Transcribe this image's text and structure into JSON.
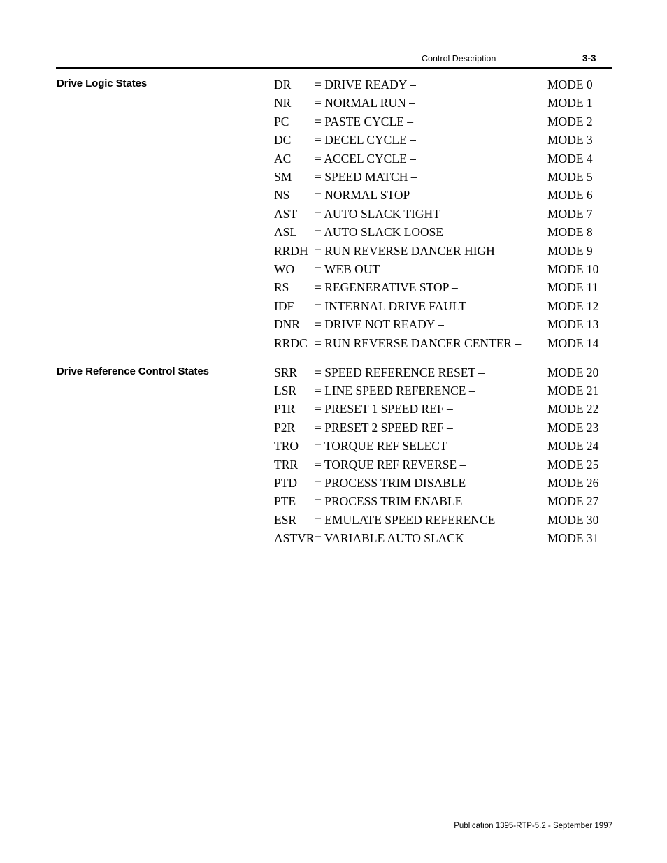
{
  "header": {
    "title": "Control Description",
    "page_number": "3-3"
  },
  "footer": {
    "text": "Publication 1395-RTP-5.2 - September 1997"
  },
  "sections": [
    {
      "heading": "Drive Logic States",
      "rows": [
        {
          "abbr": "DR",
          "desc": "= DRIVE READY –",
          "mode": "MODE 0"
        },
        {
          "abbr": "NR",
          "desc": "= NORMAL RUN –",
          "mode": "MODE 1"
        },
        {
          "abbr": "PC",
          "desc": "= PASTE CYCLE –",
          "mode": "MODE 2"
        },
        {
          "abbr": "DC",
          "desc": "= DECEL CYCLE –",
          "mode": "MODE 3"
        },
        {
          "abbr": "AC",
          "desc": "= ACCEL CYCLE –",
          "mode": "MODE 4"
        },
        {
          "abbr": "SM",
          "desc": "= SPEED MATCH –",
          "mode": "MODE 5"
        },
        {
          "abbr": "NS",
          "desc": "= NORMAL STOP –",
          "mode": "MODE 6"
        },
        {
          "abbr": "AST",
          "desc": "= AUTO SLACK TIGHT –",
          "mode": "MODE 7"
        },
        {
          "abbr": "ASL",
          "desc": "= AUTO SLACK LOOSE –",
          "mode": "MODE 8"
        },
        {
          "abbr": "RRDH",
          "desc": "= RUN REVERSE DANCER HIGH –",
          "mode": "MODE 9"
        },
        {
          "abbr": "WO",
          "desc": "= WEB OUT –",
          "mode": "MODE 10"
        },
        {
          "abbr": "RS",
          "desc": "= REGENERATIVE STOP –",
          "mode": "MODE 11"
        },
        {
          "abbr": "IDF",
          "desc": "= INTERNAL DRIVE FAULT –",
          "mode": "MODE 12"
        },
        {
          "abbr": "DNR",
          "desc": "= DRIVE NOT READY –",
          "mode": "MODE 13"
        },
        {
          "abbr": "RRDC",
          "desc": "= RUN REVERSE DANCER CENTER –",
          "mode": "MODE 14"
        }
      ]
    },
    {
      "heading": "Drive Reference Control States",
      "rows": [
        {
          "abbr": "SRR",
          "desc": "= SPEED REFERENCE RESET –",
          "mode": "MODE 20"
        },
        {
          "abbr": "LSR",
          "desc": "= LINE SPEED REFERENCE –",
          "mode": "MODE 21"
        },
        {
          "abbr": "P1R",
          "desc": "= PRESET 1 SPEED REF –",
          "mode": "MODE 22"
        },
        {
          "abbr": "P2R",
          "desc": "= PRESET 2 SPEED REF –",
          "mode": "MODE 23"
        },
        {
          "abbr": "TRO",
          "desc": "= TORQUE REF SELECT –",
          "mode": "MODE 24"
        },
        {
          "abbr": "TRR",
          "desc": "= TORQUE REF REVERSE –",
          "mode": "MODE 25"
        },
        {
          "abbr": "PTD",
          "desc": "= PROCESS TRIM DISABLE –",
          "mode": "MODE 26"
        },
        {
          "abbr": "PTE",
          "desc": "= PROCESS TRIM ENABLE –",
          "mode": "MODE 27"
        },
        {
          "abbr": "ESR",
          "desc": "= EMULATE SPEED REFERENCE –",
          "mode": "MODE 30"
        },
        {
          "abbr": "ASTVR",
          "desc": "= VARIABLE AUTO SLACK –",
          "mode": "MODE 31"
        }
      ]
    }
  ]
}
